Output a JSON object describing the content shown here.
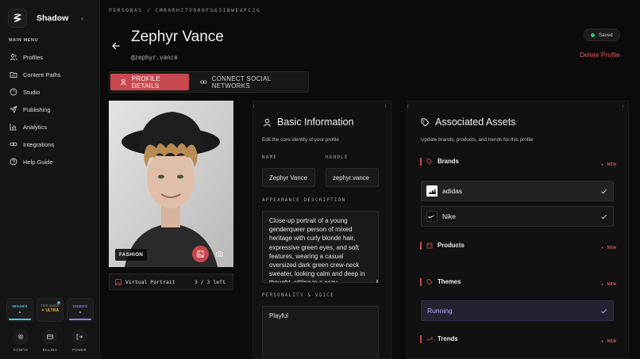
{
  "app": {
    "name": "Shadow"
  },
  "sidebar": {
    "menu_title": "MAIN MENU",
    "items": [
      {
        "label": "Profiles",
        "icon": "users-icon"
      },
      {
        "label": "Content Paths",
        "icon": "folder-icon"
      },
      {
        "label": "Studio",
        "icon": "palette-icon"
      },
      {
        "label": "Publishing",
        "icon": "send-icon"
      },
      {
        "label": "Analytics",
        "icon": "bar-chart-icon"
      },
      {
        "label": "Integrations",
        "icon": "link-icon"
      },
      {
        "label": "Help Guide",
        "icon": "help-circle-icon"
      }
    ],
    "usage": {
      "images": {
        "label": "IMAGES",
        "value": "-",
        "color": "#4fc3e8"
      },
      "tier": {
        "label": "TIER MODE",
        "value": "ULTRA",
        "color": "#f0b84a"
      },
      "videos": {
        "label": "VIDEOS",
        "value": "-",
        "color": "#9a7cf0"
      }
    },
    "actions": [
      {
        "label": "CONFIG",
        "icon": "gear-icon"
      },
      {
        "label": "BILLING",
        "icon": "credit-card-icon"
      },
      {
        "label": "POWER",
        "icon": "logout-icon"
      }
    ]
  },
  "header": {
    "breadcrumb": "PERSONAS / CMR0RHI7V000FS63IBWEXFC2G",
    "title": "Zephyr Vance",
    "handle": "@zephyr.vance",
    "saved_label": "Saved",
    "delete_label": "Delete Profile"
  },
  "tabs": [
    {
      "label": "PROFILE DETAILS",
      "active": true
    },
    {
      "label": "CONNECT SOCIAL NETWORKS",
      "active": false
    }
  ],
  "portrait": {
    "tag": "FASHION",
    "footer_label": "Virtual Portrait",
    "count": "3 / 3 left"
  },
  "basic_info": {
    "title": "Basic Information",
    "subtitle": "Edit the core identity of your profile",
    "name_label": "NAME",
    "name_value": "Zephyr Vance",
    "handle_label": "HANDLE",
    "handle_value": "zephyr.vance",
    "appearance_label": "APPEARANCE DESCRIPTION",
    "appearance_value": "Close-up portrait of a young genderqueer person of mixed heritage with curly blonde hair, expressive green eyes, and soft features, wearing a casual oversized dark green crew-neck sweater, looking calm and deep in thought, sitting in a cozy",
    "personality_label": "PERSONALITY & VOICE",
    "personality_value": "Playful"
  },
  "assets": {
    "title": "Associated Assets",
    "subtitle": "Update brands, products, and trends for this profile",
    "new_label": "+ NEW",
    "brands_label": "Brands",
    "brands": [
      "adidas",
      "Nike"
    ],
    "products_label": "Products",
    "themes_label": "Themes",
    "themes": [
      "Running"
    ],
    "trends_label": "Trends"
  },
  "colors": {
    "accent": "#c8484f",
    "saved": "#3ec26a",
    "theme_text": "#b7a8ec"
  }
}
